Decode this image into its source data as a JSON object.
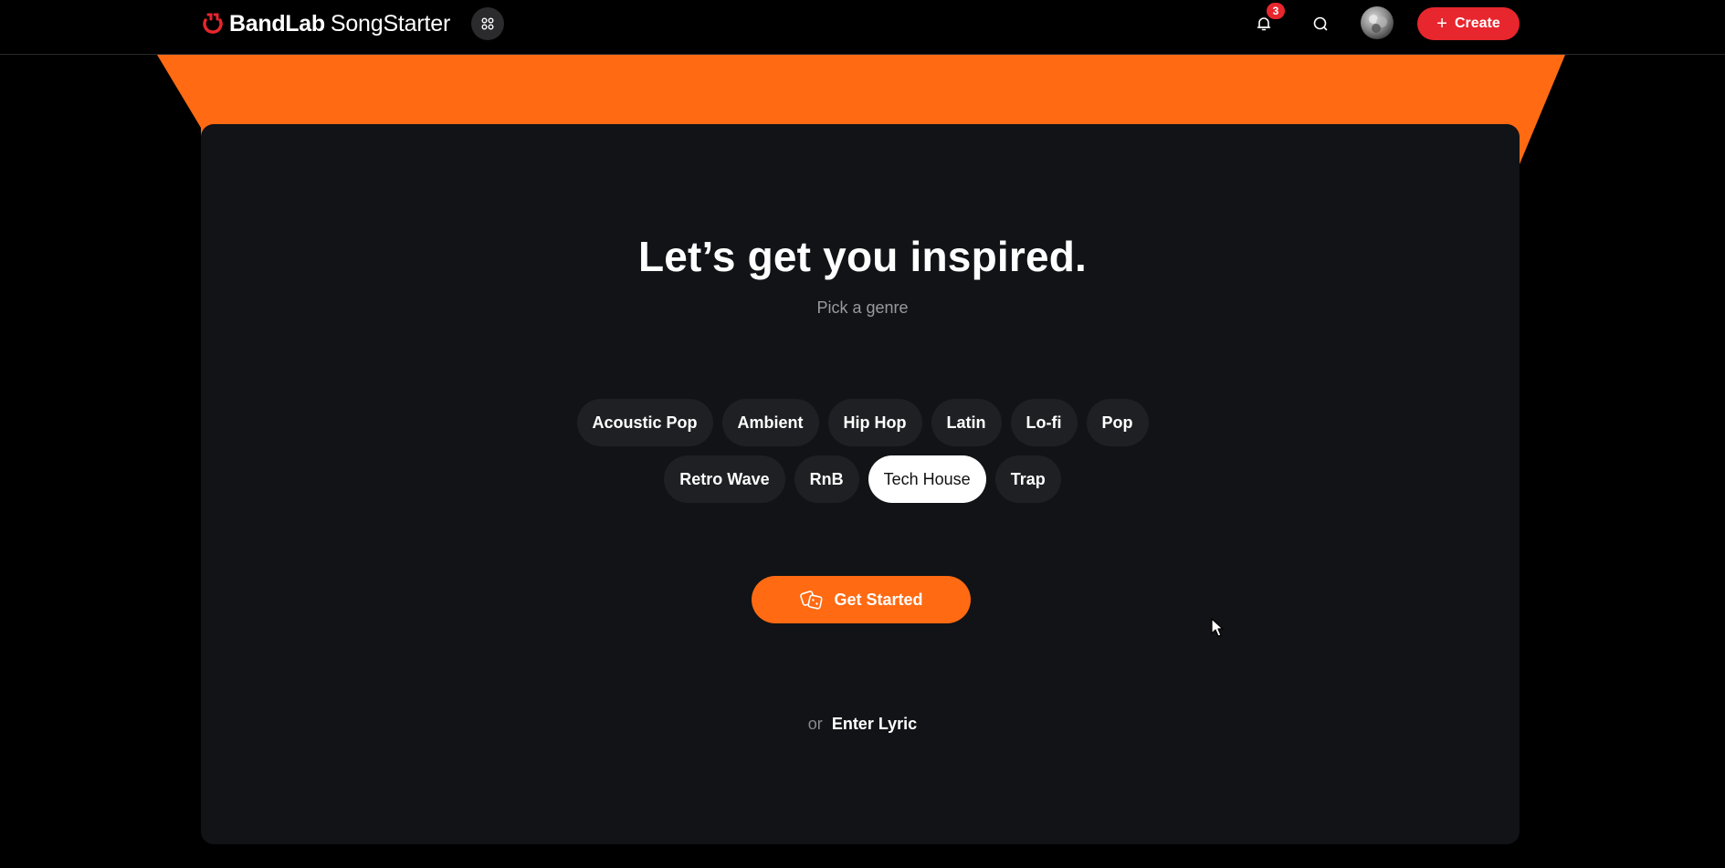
{
  "header": {
    "brand_name": "BandLab",
    "product_name": "SongStarter",
    "notifications_count": "3",
    "create_label": "Create",
    "icons": [
      "bandlab-logo-icon",
      "apps-grid-icon",
      "bell-icon",
      "search-icon",
      "avatar",
      "plus-icon"
    ]
  },
  "main": {
    "headline": "Let’s get you inspired.",
    "subheadline": "Pick a genre",
    "genres_row1": [
      "Acoustic Pop",
      "Ambient",
      "Hip Hop",
      "Latin",
      "Lo-fi",
      "Pop"
    ],
    "genres_row2": [
      "Retro Wave",
      "RnB",
      "Tech House",
      "Trap"
    ],
    "selected_genre": "Tech House",
    "get_started_label": "Get Started",
    "or_label": "or",
    "enter_lyric_label": "Enter Lyric"
  },
  "colors": {
    "accent_orange": "#ff6a13",
    "create_red": "#e8262d",
    "card_bg": "#111316",
    "chip_bg": "#1e2023"
  }
}
